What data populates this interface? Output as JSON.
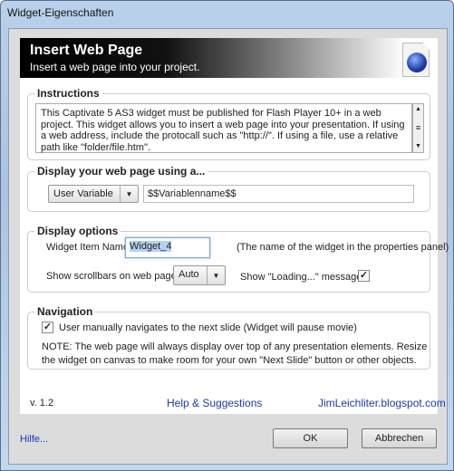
{
  "window": {
    "title": "Widget-Eigenschaften"
  },
  "header": {
    "title": "Insert Web Page",
    "subtitle": "Insert a web page into your project.",
    "icon": "web-page-globe-icon"
  },
  "instructions": {
    "legend": "Instructions",
    "text": "This Captivate 5 AS3 widget must be published for Flash Player 10+ in a web project.  This widget allows you to insert a web page into your presentation.  If using a web address, include the protocall such as \"http://\".   If using a file, use a relative path like \"folder/file.htm\"."
  },
  "display_using": {
    "legend": "Display your web page using a...",
    "type_selected": "User Variable",
    "value": "$$Variablenname$$"
  },
  "display_options": {
    "legend": "Display options",
    "item_name_label": "Widget Item Name",
    "item_name_value": "Widget_4",
    "item_name_hint": "(The name of the widget in the properties panel)",
    "scrollbars_label": "Show scrollbars on web page",
    "scrollbars_selected": "Auto",
    "loading_label": "Show \"Loading...\" message",
    "loading_checked": true
  },
  "navigation": {
    "legend": "Navigation",
    "manual_label": "User manually navigates to the next slide (Widget will pause movie)",
    "manual_checked": true,
    "note": "NOTE:  The web page will always display over top of any presentation elements.  Resize the widget on canvas to make room for your own \"Next Slide\" button or other objects."
  },
  "footer": {
    "version": "v. 1.2",
    "help_link": "Help & Suggestions",
    "site_link": "JimLeichliter.blogspot.com"
  },
  "buttons": {
    "help": "Hilfe...",
    "ok": "OK",
    "cancel": "Abbrechen"
  }
}
